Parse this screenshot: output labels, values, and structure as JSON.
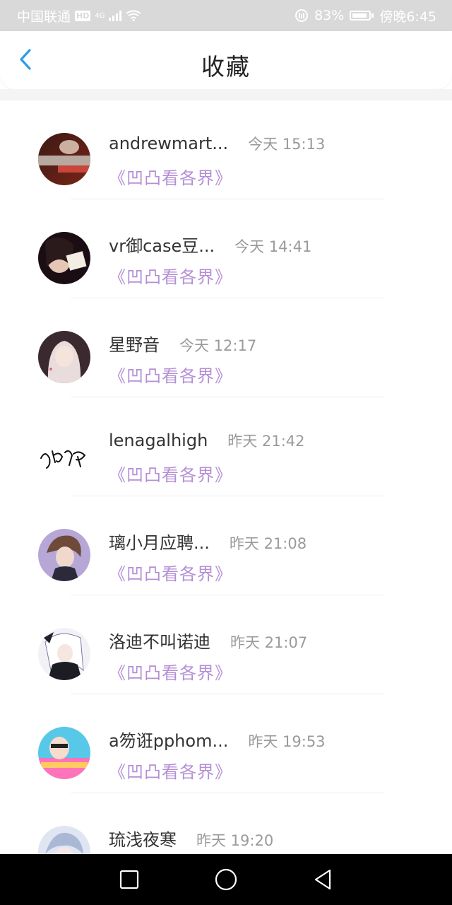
{
  "status_bar": {
    "carrier": "中国联通",
    "network": "4G",
    "battery": "83%",
    "time": "傍晚6:45"
  },
  "header": {
    "title": "收藏",
    "back_icon": "chevron-left-icon",
    "accent": "#2a9ee8"
  },
  "colors": {
    "subtitle": "#b48fd6",
    "time": "#9a9a9a"
  },
  "items": [
    {
      "name": "andrewmart...",
      "time": "今天 15:13",
      "subtitle": "《凹凸看各界》",
      "avatar": "avatar-1"
    },
    {
      "name": "vr御case豆...",
      "time": "今天 14:41",
      "subtitle": "《凹凸看各界》",
      "avatar": "avatar-2"
    },
    {
      "name": "星野音",
      "time": "今天 12:17",
      "subtitle": "《凹凸看各界》",
      "avatar": "avatar-3"
    },
    {
      "name": "lenagalhigh",
      "time": "昨天 21:42",
      "subtitle": "《凹凸看各界》",
      "avatar": "avatar-4"
    },
    {
      "name": "璃小月应聘...",
      "time": "昨天 21:08",
      "subtitle": "《凹凸看各界》",
      "avatar": "avatar-5"
    },
    {
      "name": "洛迪不叫诺迪",
      "time": "昨天 21:07",
      "subtitle": "《凹凸看各界》",
      "avatar": "avatar-6"
    },
    {
      "name": "a笏诳pphom...",
      "time": "昨天 19:53",
      "subtitle": "《凹凸看各界》",
      "avatar": "avatar-7"
    },
    {
      "name": "琉浅夜寒",
      "time": "昨天 19:20",
      "subtitle": "",
      "avatar": "avatar-8"
    }
  ],
  "nav": {
    "recent": "square-icon",
    "home": "circle-icon",
    "back": "triangle-back-icon"
  }
}
